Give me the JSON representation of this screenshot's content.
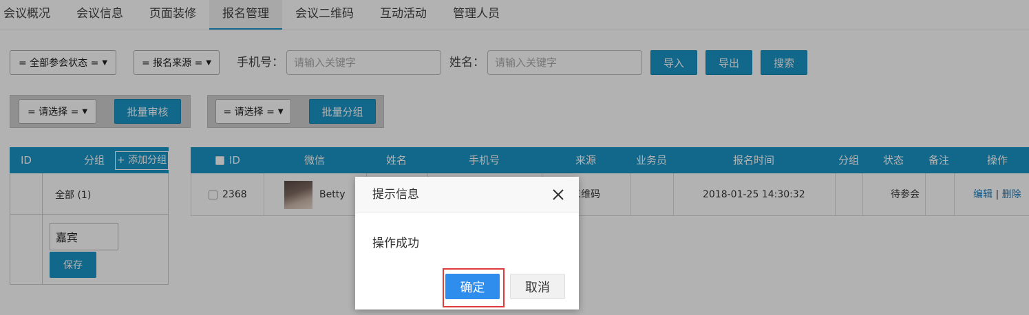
{
  "tabs": [
    {
      "label": "会议概况"
    },
    {
      "label": "会议信息"
    },
    {
      "label": "页面装修"
    },
    {
      "label": "报名管理",
      "active": true
    },
    {
      "label": "会议二维码"
    },
    {
      "label": "互动活动"
    },
    {
      "label": "管理人员"
    }
  ],
  "filters": {
    "status_select": "= 全部参会状态 =",
    "source_select": "= 报名来源 =",
    "phone_label": "手机号：",
    "phone_placeholder": "请输入关键字",
    "name_label": "姓名：",
    "name_placeholder": "请输入关键字",
    "import_label": "导入",
    "export_label": "导出",
    "search_label": "搜索"
  },
  "batch": {
    "review_select": "= 请选择 =",
    "review_button": "批量审核",
    "group_select": "= 请选择 =",
    "group_button": "批量分组"
  },
  "group_table": {
    "col_id": "ID",
    "col_group": "分组",
    "add_button": "+ 添加分组",
    "all_label": "全部 (1)",
    "new_group_value": "嘉宾",
    "save_button": "保存"
  },
  "main_table": {
    "headers": {
      "id": "ID",
      "wechat": "微信",
      "name": "姓名",
      "phone": "手机号",
      "source": "来源",
      "salesperson": "业务员",
      "reg_time": "报名时间",
      "group": "分组",
      "status": "状态",
      "remark": "备注",
      "actions": "操作"
    },
    "rows": [
      {
        "id": "2368",
        "wechat_name": "Betty",
        "source": "二维码",
        "reg_time": "2018-01-25 14:30:32",
        "status": "待参会",
        "edit": "编辑",
        "sep": "|",
        "delete": "删除"
      }
    ]
  },
  "dialog": {
    "title": "提示信息",
    "message": "操作成功",
    "ok_label": "确定",
    "cancel_label": "取消"
  },
  "colors": {
    "accent": "#1b96c8",
    "dialog_ok": "#2e8ded",
    "highlight": "#e03b3b"
  }
}
